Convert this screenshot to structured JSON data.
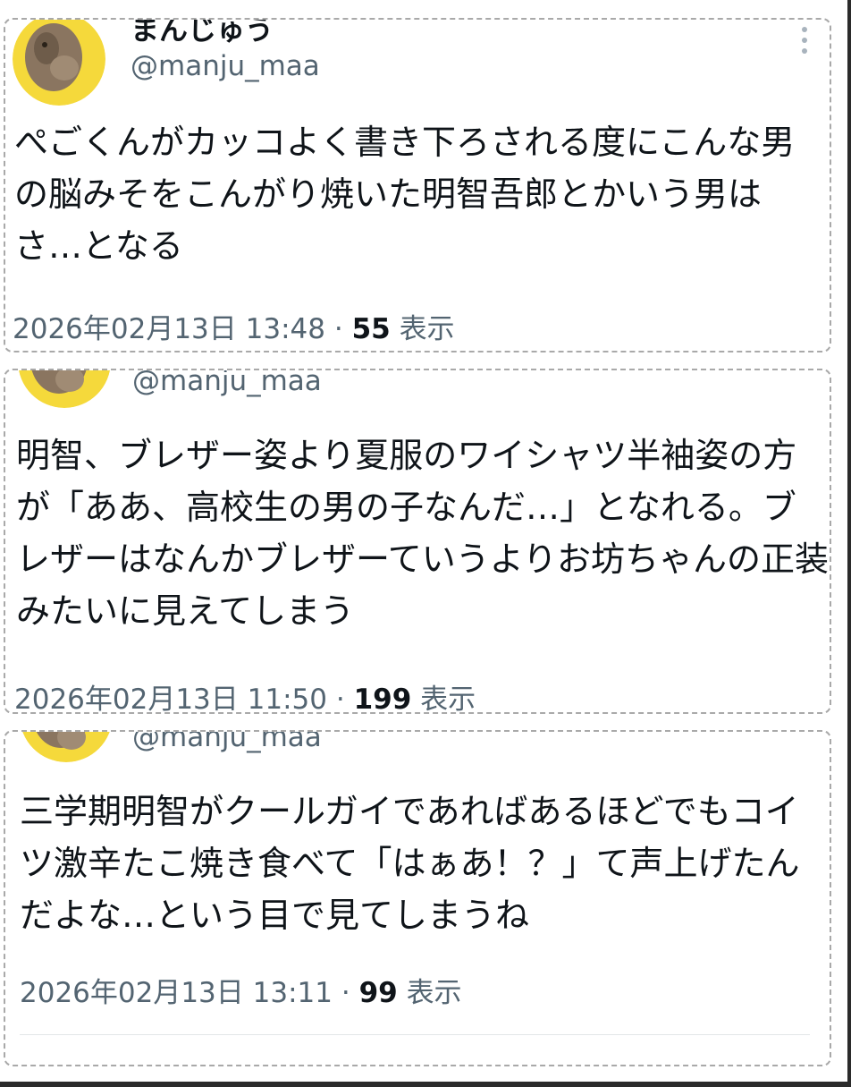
{
  "tweets": [
    {
      "display_name": "まんじゅう",
      "handle": "@manju_maa",
      "text": "ぺごくんがカッコよく書き下ろされる度にこんな男の脳みそをこんがり焼いた明智吾郎とかいう男はさ…となる",
      "timestamp": "2026年02月13日 13:48",
      "separator": "·",
      "views_count": "55",
      "views_label": "表示"
    },
    {
      "handle": "@manju_maa",
      "text": "明智、ブレザー姿より夏服のワイシャツ半袖姿の方が「ああ、高校生の男の子なんだ…」となれる。ブレザーはなんかブレザーていうよりお坊ちゃんの正装みたいに見えてしまう",
      "timestamp": "2026年02月13日 11:50",
      "separator": "·",
      "views_count": "199",
      "views_label": "表示"
    },
    {
      "handle": "@manju_maa",
      "text": "三学期明智がクールガイであればあるほどでもコイツ激辛たこ焼き食べて「はぁあ！？」て声上げたんだよな…という目で見てしまうね",
      "timestamp": "2026年02月13日 13:11",
      "separator": "·",
      "views_count": "99",
      "views_label": "表示"
    }
  ],
  "icons": {
    "avatar": "avatar-photo",
    "more": "more-options-icon"
  },
  "colors": {
    "text_primary": "#0f1419",
    "text_secondary": "#536471",
    "avatar_bg": "#f5d93b",
    "card_border": "#a9a9a9"
  }
}
